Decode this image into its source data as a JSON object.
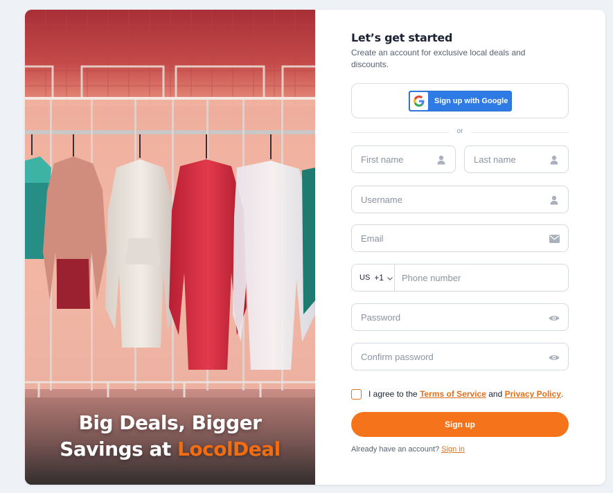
{
  "hero": {
    "title_line1": "Big Deals, Bigger",
    "title_line2_prefix": "Savings at ",
    "brand": "LocolDeal",
    "brand_color": "#f26d12"
  },
  "form": {
    "heading": "Let’s get started",
    "subheading": "Create an account for exclusive local deals and discounts.",
    "google_button": "Sign up with Google",
    "divider_text": "or",
    "fields": {
      "first_name": {
        "placeholder": "First name",
        "icon": "user-icon"
      },
      "last_name": {
        "placeholder": "Last name",
        "icon": "user-icon"
      },
      "username": {
        "placeholder": "Username",
        "icon": "user-icon"
      },
      "email": {
        "placeholder": "Email",
        "icon": "mail-icon"
      },
      "phone": {
        "country_code": "US",
        "dial_code": "+1",
        "placeholder": "Phone number",
        "icon": "chevron-down-icon"
      },
      "password": {
        "placeholder": "Password",
        "icon": "eye-icon"
      },
      "confirm_password": {
        "placeholder": "Confirm password",
        "icon": "eye-icon"
      }
    },
    "consent": {
      "prefix": "I agree to the ",
      "terms_link": "Terms of Service",
      "and": " and ",
      "privacy_link": "Privacy Policy",
      "suffix": "."
    },
    "signup_button": "Sign up",
    "signin": {
      "prompt": "Already have an account? ",
      "link": "Sign in"
    },
    "accent_color": "#f5731a",
    "google_blue": "#2f7be5"
  }
}
